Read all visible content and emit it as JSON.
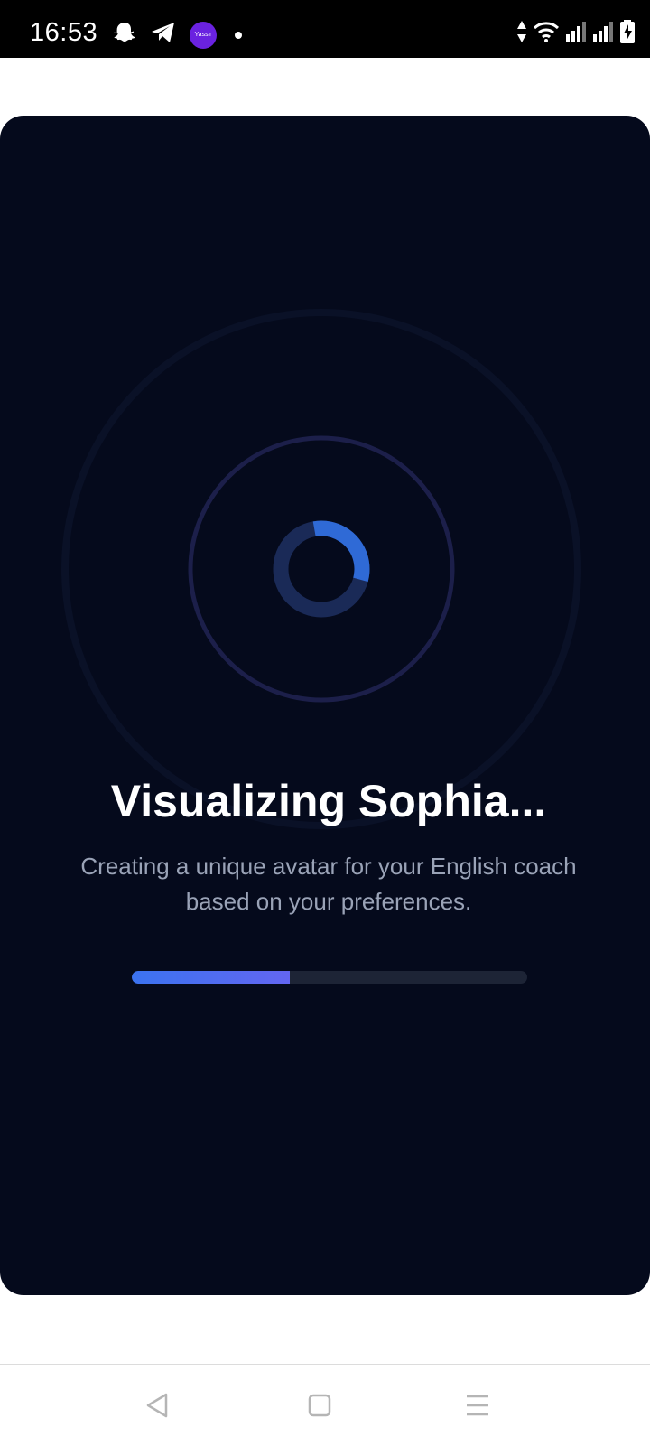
{
  "status_bar": {
    "time": "16:53",
    "app_badge": "Yassir",
    "left_icons": [
      "snapchat-icon",
      "telegram-icon",
      "yassir-app-icon",
      "notification-dot"
    ],
    "right_icons": [
      "data-arrows-icon",
      "wifi-icon",
      "signal-icon",
      "signal-icon",
      "battery-charging-icon"
    ]
  },
  "loader": {
    "title": "Visualizing Sophia...",
    "subtitle": "Creating a unique avatar for your English coach based on your preferences.",
    "progress": 0.4
  },
  "colors": {
    "card_background": "#050a1c",
    "accent": "#3b73f0",
    "accent_end": "#6366f1",
    "progress_track": "#1d2436"
  },
  "nav_bar": {
    "buttons": [
      "back-icon",
      "home-icon",
      "menu-icon"
    ]
  }
}
